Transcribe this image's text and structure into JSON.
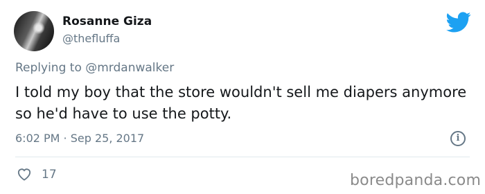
{
  "author": {
    "name": "Rosanne Giza",
    "handle": "@thefluffa"
  },
  "reply": {
    "prefix": "Replying to",
    "mention": "@mrdanwalker"
  },
  "tweet": {
    "text": "I told my boy that the store wouldn't sell me diapers anymore so he'd have to use the potty.",
    "timestamp": "6:02 PM · Sep 25, 2017"
  },
  "stats": {
    "likes": "17"
  },
  "watermark": "boredpanda.com",
  "colors": {
    "twitter_blue": "#1da1f2",
    "secondary_text": "#657786",
    "primary_text": "#14171a"
  },
  "icons": {
    "brand": "twitter-bird-icon",
    "info": "info-icon",
    "like": "heart-icon"
  }
}
